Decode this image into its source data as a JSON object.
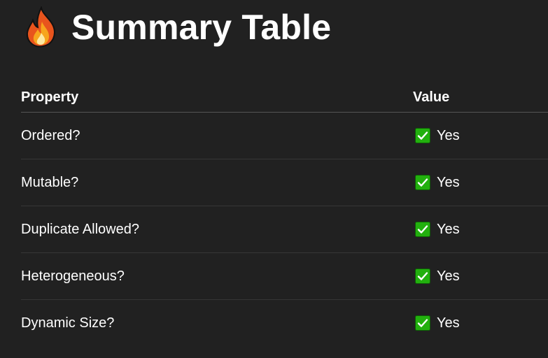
{
  "heading": {
    "icon": "fire-icon",
    "title": "Summary Table"
  },
  "table": {
    "columns": [
      "Property",
      "Value"
    ],
    "rows": [
      {
        "property": "Ordered?",
        "value": "Yes",
        "icon": "check-mark-icon"
      },
      {
        "property": "Mutable?",
        "value": "Yes",
        "icon": "check-mark-icon"
      },
      {
        "property": "Duplicate Allowed?",
        "value": "Yes",
        "icon": "check-mark-icon"
      },
      {
        "property": "Heterogeneous?",
        "value": "Yes",
        "icon": "check-mark-icon"
      },
      {
        "property": "Dynamic Size?",
        "value": "Yes",
        "icon": "check-mark-icon"
      }
    ]
  },
  "colors": {
    "background": "#212121",
    "text": "#ffffff",
    "check_green": "#22b00e",
    "divider": "#363636"
  }
}
